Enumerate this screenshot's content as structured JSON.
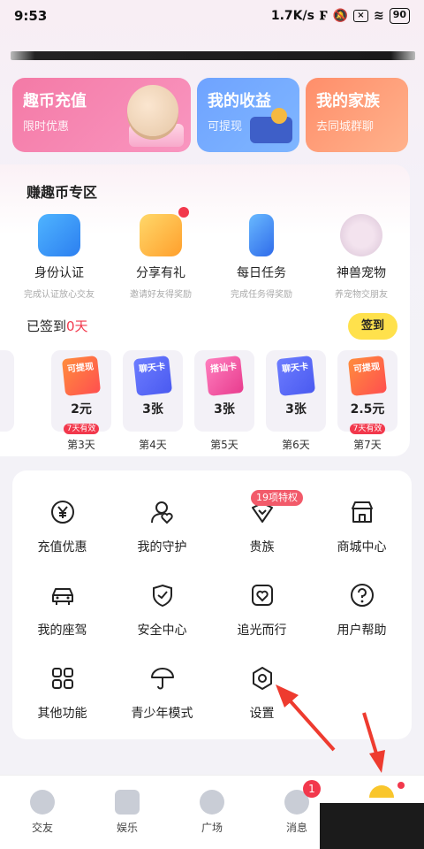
{
  "status": {
    "time": "9:53",
    "speed": "1.7K/s",
    "battery": "90"
  },
  "cards": [
    {
      "title": "趣币充值",
      "sub": "限时优惠"
    },
    {
      "title": "我的收益",
      "sub": "可提现"
    },
    {
      "title": "我的家族",
      "sub": "去同城群聊"
    }
  ],
  "earn": {
    "title": "赚趣币专区",
    "features": [
      {
        "label": "身份认证",
        "sub": "完成认证放心交友"
      },
      {
        "label": "分享有礼",
        "sub": "邀请好友得奖励"
      },
      {
        "label": "每日任务",
        "sub": "完成任务得奖励"
      },
      {
        "label": "神兽宠物",
        "sub": "养宠物交朋友"
      }
    ],
    "sign_prefix": "已签到",
    "sign_days": "0天",
    "sign_button": "签到",
    "days": [
      {
        "ticket": "可提现",
        "value": "2元",
        "exp": "7天有效",
        "label": "第3天"
      },
      {
        "ticket": "聊天卡",
        "value": "3张",
        "label": "第4天"
      },
      {
        "ticket": "搭讪卡",
        "value": "3张",
        "label": "第5天"
      },
      {
        "ticket": "聊天卡",
        "value": "3张",
        "label": "第6天"
      },
      {
        "ticket": "可提现",
        "value": "2.5元",
        "exp": "7天有效",
        "label": "第7天"
      }
    ]
  },
  "menu": {
    "badge": "19项特权",
    "items": [
      {
        "label": "充值优惠",
        "icon": "yen-icon"
      },
      {
        "label": "我的守护",
        "icon": "user-heart-icon"
      },
      {
        "label": "贵族",
        "icon": "crown-heart-icon"
      },
      {
        "label": "商城中心",
        "icon": "store-icon"
      },
      {
        "label": "我的座驾",
        "icon": "car-icon"
      },
      {
        "label": "安全中心",
        "icon": "shield-icon"
      },
      {
        "label": "追光而行",
        "icon": "heart-frame-icon"
      },
      {
        "label": "用户帮助",
        "icon": "help-icon"
      },
      {
        "label": "其他功能",
        "icon": "grid-icon"
      },
      {
        "label": "青少年模式",
        "icon": "umbrella-icon"
      },
      {
        "label": "设置",
        "icon": "settings-icon"
      }
    ]
  },
  "nav": [
    {
      "label": "交友"
    },
    {
      "label": "娱乐"
    },
    {
      "label": "广场"
    },
    {
      "label": "消息",
      "badge": "1"
    },
    {
      "label": ""
    }
  ],
  "colors": {
    "accent": "#f2384c",
    "sign": "#ffe14c",
    "arrow": "#ee3b2f"
  }
}
